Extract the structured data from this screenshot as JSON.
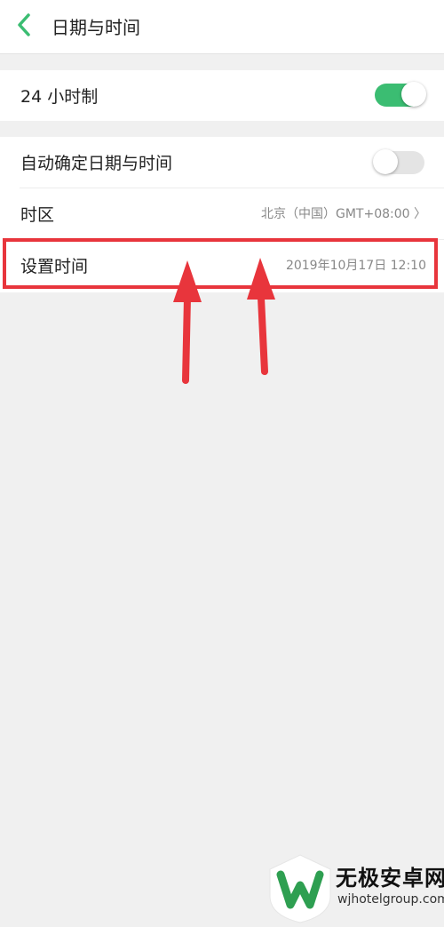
{
  "header": {
    "title": "日期与时间",
    "back_icon": "chevron-left-icon",
    "accent": "#3bbd72"
  },
  "settings": {
    "hour24": {
      "label": "24 小时制",
      "enabled": true
    },
    "auto": {
      "label": "自动确定日期与时间",
      "enabled": false
    },
    "timezone": {
      "label": "时区",
      "value": "北京（中国）GMT+08:00 〉"
    },
    "set_time": {
      "label": "设置时间",
      "value": "2019年10月17日  12:10"
    }
  },
  "annotation": {
    "color": "#e8353c"
  },
  "watermark": {
    "brand": "无极安卓网",
    "url": "wjhotelgroup.com"
  }
}
